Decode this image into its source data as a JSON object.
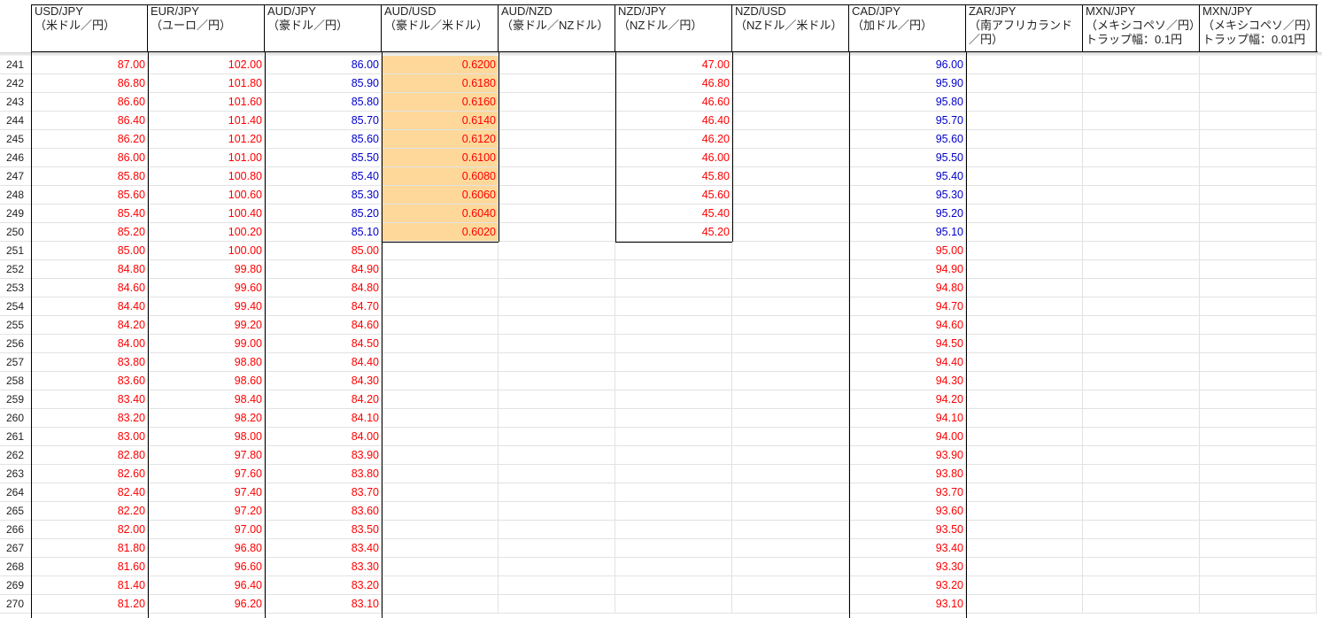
{
  "colors": {
    "red": "#ff0000",
    "blue": "#0000cc",
    "highlight": "#fdd89a"
  },
  "headers": [
    {
      "id": "usdjpy",
      "lines": [
        "USD/JPY",
        "（米ドル／円）"
      ]
    },
    {
      "id": "eurjpy",
      "lines": [
        "EUR/JPY",
        "（ユーロ／円）"
      ]
    },
    {
      "id": "audjpy",
      "lines": [
        "AUD/JPY",
        "（豪ドル／円）"
      ]
    },
    {
      "id": "audusd",
      "lines": [
        "AUD/USD",
        "（豪ドル／米ドル）"
      ]
    },
    {
      "id": "audnzd",
      "lines": [
        "AUD/NZD",
        "（豪ドル／NZドル）"
      ]
    },
    {
      "id": "nzdjpy",
      "lines": [
        "NZD/JPY",
        "（NZドル／円）"
      ]
    },
    {
      "id": "nzdusd",
      "lines": [
        "NZD/USD",
        "（NZドル／米ドル）"
      ]
    },
    {
      "id": "cadjpy",
      "lines": [
        "CAD/JPY",
        "（加ドル／円）"
      ]
    },
    {
      "id": "zarjpy",
      "lines": [
        "ZAR/JPY",
        "（南アフリカランド",
        "／円）"
      ]
    },
    {
      "id": "mxnjpy1",
      "lines": [
        "MXN/JPY",
        "（メキシコペソ／円）",
        "トラップ幅：0.1円"
      ]
    },
    {
      "id": "mxnjpy2",
      "lines": [
        "MXN/JPY",
        "（メキシコペソ／円）",
        "トラップ幅：0.01円"
      ]
    }
  ],
  "row_numbers": [
    "241",
    "242",
    "243",
    "244",
    "245",
    "246",
    "247",
    "248",
    "249",
    "250",
    "251",
    "252",
    "253",
    "254",
    "255",
    "256",
    "257",
    "258",
    "259",
    "260",
    "261",
    "262",
    "263",
    "264",
    "265",
    "266",
    "267",
    "268",
    "269",
    "270"
  ],
  "columns": {
    "usdjpy": [
      "87.00",
      "86.80",
      "86.60",
      "86.40",
      "86.20",
      "86.00",
      "85.80",
      "85.60",
      "85.40",
      "85.20",
      "85.00",
      "84.80",
      "84.60",
      "84.40",
      "84.20",
      "84.00",
      "83.80",
      "83.60",
      "83.40",
      "83.20",
      "83.00",
      "82.80",
      "82.60",
      "82.40",
      "82.20",
      "82.00",
      "81.80",
      "81.60",
      "81.40",
      "81.20"
    ],
    "eurjpy": [
      "102.00",
      "101.80",
      "101.60",
      "101.40",
      "101.20",
      "101.00",
      "100.80",
      "100.60",
      "100.40",
      "100.20",
      "100.00",
      "99.80",
      "99.60",
      "99.40",
      "99.20",
      "99.00",
      "98.80",
      "98.60",
      "98.40",
      "98.20",
      "98.00",
      "97.80",
      "97.60",
      "97.40",
      "97.20",
      "97.00",
      "96.80",
      "96.60",
      "96.40",
      "96.20"
    ],
    "audjpy": [
      "86.00",
      "85.90",
      "85.80",
      "85.70",
      "85.60",
      "85.50",
      "85.40",
      "85.30",
      "85.20",
      "85.10",
      "85.00",
      "84.90",
      "84.80",
      "84.70",
      "84.60",
      "84.50",
      "84.40",
      "84.30",
      "84.20",
      "84.10",
      "84.00",
      "83.90",
      "83.80",
      "83.70",
      "83.60",
      "83.50",
      "83.40",
      "83.30",
      "83.20",
      "83.10"
    ],
    "audusd": [
      "0.6200",
      "0.6180",
      "0.6160",
      "0.6140",
      "0.6120",
      "0.6100",
      "0.6080",
      "0.6060",
      "0.6040",
      "0.6020"
    ],
    "nzdjpy": [
      "47.00",
      "46.80",
      "46.60",
      "46.40",
      "46.20",
      "46.00",
      "45.80",
      "45.60",
      "45.40",
      "45.20"
    ],
    "cadjpy": [
      "96.00",
      "95.90",
      "95.80",
      "95.70",
      "95.60",
      "95.50",
      "95.40",
      "95.30",
      "95.20",
      "95.10",
      "95.00",
      "94.90",
      "94.80",
      "94.70",
      "94.60",
      "94.50",
      "94.40",
      "94.30",
      "94.20",
      "94.10",
      "94.00",
      "93.90",
      "93.80",
      "93.70",
      "93.60",
      "93.50",
      "93.40",
      "93.30",
      "93.20",
      "93.10"
    ]
  },
  "column_colors": {
    "usdjpy": "red",
    "eurjpy": "red",
    "audjpy": "mixed",
    "audusd": "red",
    "nzdjpy": "red",
    "cadjpy": "mixed"
  },
  "blue_rows": {
    "audjpy": 10,
    "cadjpy": 10
  }
}
